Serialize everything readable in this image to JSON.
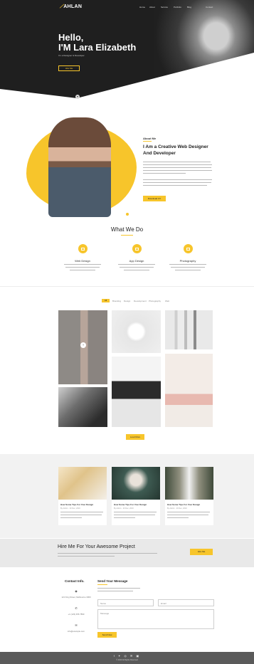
{
  "header": {
    "logo": "AHLAN",
    "logo_mark": "⟋",
    "nav": [
      "Home",
      "About",
      "Service",
      "Portfolio",
      "Blog",
      "Contact"
    ]
  },
  "hero": {
    "greeting": "Hello,",
    "name": "I'M Lara Elizabeth",
    "subtitle": "I'm a Designer & Developer",
    "button": "Hire Me",
    "scroll_icon": "▾"
  },
  "about": {
    "label": "About Me",
    "title_line1": "I Am a Creative Web Designer",
    "title_line2": "And Developer",
    "button": "Download CV"
  },
  "services": {
    "title": "What We Do",
    "items": [
      {
        "label": "Web Design"
      },
      {
        "label": "App Design"
      },
      {
        "label": "Photography"
      }
    ]
  },
  "portfolio": {
    "filters": [
      "All",
      "Branding",
      "Design",
      "Development",
      "Photography",
      "Web"
    ],
    "load_more": "Load More"
  },
  "blog": {
    "cards": [
      {
        "title": "How Some Tips For Your Design",
        "meta": "By Admin · 20 Dec, 2019"
      },
      {
        "title": "How Some Tips For Your Design",
        "meta": "By Admin · 20 Dec, 2019"
      },
      {
        "title": "How Some Tips For Your Design",
        "meta": "By Admin · 20 Dec, 2019"
      }
    ]
  },
  "hire": {
    "title": "Hire Me For Your Awesome Project",
    "button": "Hire Me"
  },
  "contact": {
    "info_title": "Contact Info.",
    "form_title": "Send Your Message",
    "items": [
      {
        "icon": "◉",
        "text": "121 King Street, Melbourne 3000"
      },
      {
        "icon": "✆",
        "text": "+1 (123) 456 7890"
      },
      {
        "icon": "✉",
        "text": "info@example.com"
      }
    ],
    "name_placeholder": "Name",
    "email_placeholder": "Email",
    "message_placeholder": "Message",
    "send_button": "Send Now"
  },
  "footer": {
    "social": "f ✦ ◎ ✉ ▣",
    "copyright": "© 2020 All Rights Reserved"
  },
  "colors": {
    "accent": "#f7c52b",
    "dark": "#1f1f1f",
    "footer": "#5a5a5a"
  }
}
